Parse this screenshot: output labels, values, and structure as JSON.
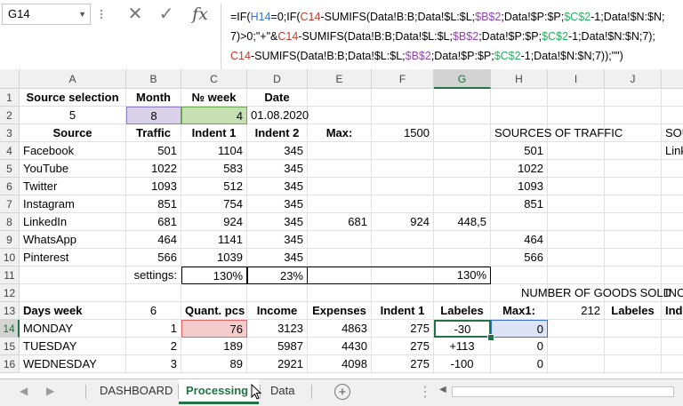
{
  "formula_bar": {
    "name_box": "G14",
    "formula_lines": [
      [
        [
          "=IF(",
          ""
        ],
        [
          "H14",
          "b"
        ],
        [
          "=0;IF(",
          ""
        ],
        [
          "C14",
          "r"
        ],
        [
          "-SUMIFS(Data!B:B;Data!$L:$L;",
          ""
        ],
        [
          "$B$2",
          "p"
        ],
        [
          ";Data!$P:$P;",
          ""
        ],
        [
          "$C$2",
          "g"
        ],
        [
          "-1;Data!$N:$N;",
          ""
        ]
      ],
      [
        [
          "7)>0;\"+\"&",
          ""
        ],
        [
          "C14",
          "r"
        ],
        [
          "-SUMIFS(Data!B:B;Data!$L:$L;",
          ""
        ],
        [
          "$B$2",
          "p"
        ],
        [
          ";Data!$P:$P;",
          ""
        ],
        [
          "$C$2",
          "g"
        ],
        [
          "-1;Data!$N:$N;7);",
          ""
        ]
      ],
      [
        [
          "C14",
          "r"
        ],
        [
          "-SUMIFS(Data!B:B;Data!$L:$L;",
          ""
        ],
        [
          "$B$2",
          "p"
        ],
        [
          ";Data!$P:$P;",
          ""
        ],
        [
          "$C$2",
          "g"
        ],
        [
          "-1;Data!$N:$N;7));\"\")",
          ""
        ]
      ]
    ]
  },
  "columns": [
    "A",
    "B",
    "C",
    "D",
    "E",
    "F",
    "G",
    "H",
    "I",
    "J"
  ],
  "rows": [
    1,
    2,
    3,
    4,
    5,
    6,
    7,
    8,
    9,
    10,
    11,
    12,
    13,
    14,
    15,
    16
  ],
  "selected_cell": "G14",
  "cells": [
    {
      "r": 1,
      "c": "A",
      "v": "Source selection",
      "s": "b c"
    },
    {
      "r": 1,
      "c": "B",
      "v": "Month",
      "s": "b c"
    },
    {
      "r": 1,
      "c": "C",
      "v": "№ week",
      "s": "b c"
    },
    {
      "r": 1,
      "c": "D",
      "v": "Date",
      "s": "b c"
    },
    {
      "r": 2,
      "c": "A",
      "v": "5",
      "s": "c"
    },
    {
      "r": 2,
      "c": "B",
      "v": "8",
      "s": "c",
      "bg": "#d9d2e9",
      "bd": "#8e7cc3"
    },
    {
      "r": 2,
      "c": "C",
      "v": "4",
      "s": "r",
      "bg": "#c6e0b4",
      "bd": "#6aa84f"
    },
    {
      "r": 2,
      "c": "D",
      "v": "01.08.2020",
      "s": "r"
    },
    {
      "r": 3,
      "c": "A",
      "v": "Source",
      "s": "b c"
    },
    {
      "r": 3,
      "c": "B",
      "v": "Traffic",
      "s": "b c"
    },
    {
      "r": 3,
      "c": "C",
      "v": "Indent 1",
      "s": "b c"
    },
    {
      "r": 3,
      "c": "D",
      "v": "Indent 2",
      "s": "b c"
    },
    {
      "r": 3,
      "c": "E",
      "v": "Max:",
      "s": "b c"
    },
    {
      "r": 3,
      "c": "F",
      "v": "1500",
      "s": "r"
    },
    {
      "r": 3,
      "c": "H",
      "v": "SOURCES OF TRAFFIC",
      "s": "l"
    },
    {
      "r": 3,
      "c": "J2",
      "v": "SOU",
      "s": "l"
    },
    {
      "r": 4,
      "c": "A",
      "v": "Facebook",
      "s": "l"
    },
    {
      "r": 4,
      "c": "B",
      "v": "501",
      "s": "r"
    },
    {
      "r": 4,
      "c": "C",
      "v": "1104",
      "s": "r"
    },
    {
      "r": 4,
      "c": "D",
      "v": "345",
      "s": "r"
    },
    {
      "r": 4,
      "c": "H",
      "v": "501",
      "s": "r"
    },
    {
      "r": 4,
      "c": "J2",
      "v": "Link",
      "s": "l"
    },
    {
      "r": 5,
      "c": "A",
      "v": "YouTube",
      "s": "l"
    },
    {
      "r": 5,
      "c": "B",
      "v": "1022",
      "s": "r"
    },
    {
      "r": 5,
      "c": "C",
      "v": "583",
      "s": "r"
    },
    {
      "r": 5,
      "c": "D",
      "v": "345",
      "s": "r"
    },
    {
      "r": 5,
      "c": "H",
      "v": "1022",
      "s": "r"
    },
    {
      "r": 6,
      "c": "A",
      "v": "Twitter",
      "s": "l"
    },
    {
      "r": 6,
      "c": "B",
      "v": "1093",
      "s": "r"
    },
    {
      "r": 6,
      "c": "C",
      "v": "512",
      "s": "r"
    },
    {
      "r": 6,
      "c": "D",
      "v": "345",
      "s": "r"
    },
    {
      "r": 6,
      "c": "H",
      "v": "1093",
      "s": "r"
    },
    {
      "r": 7,
      "c": "A",
      "v": "Instagram",
      "s": "l"
    },
    {
      "r": 7,
      "c": "B",
      "v": "851",
      "s": "r"
    },
    {
      "r": 7,
      "c": "C",
      "v": "754",
      "s": "r"
    },
    {
      "r": 7,
      "c": "D",
      "v": "345",
      "s": "r"
    },
    {
      "r": 7,
      "c": "H",
      "v": "851",
      "s": "r"
    },
    {
      "r": 8,
      "c": "A",
      "v": "LinkedIn",
      "s": "l"
    },
    {
      "r": 8,
      "c": "B",
      "v": "681",
      "s": "r"
    },
    {
      "r": 8,
      "c": "C",
      "v": "924",
      "s": "r"
    },
    {
      "r": 8,
      "c": "D",
      "v": "345",
      "s": "r"
    },
    {
      "r": 8,
      "c": "E",
      "v": "681",
      "s": "r"
    },
    {
      "r": 8,
      "c": "F",
      "v": "924",
      "s": "r"
    },
    {
      "r": 8,
      "c": "G",
      "v": "448,5",
      "s": "r"
    },
    {
      "r": 9,
      "c": "A",
      "v": "WhatsApp",
      "s": "l"
    },
    {
      "r": 9,
      "c": "B",
      "v": "464",
      "s": "r"
    },
    {
      "r": 9,
      "c": "C",
      "v": "1141",
      "s": "r"
    },
    {
      "r": 9,
      "c": "D",
      "v": "345",
      "s": "r"
    },
    {
      "r": 9,
      "c": "H",
      "v": "464",
      "s": "r"
    },
    {
      "r": 10,
      "c": "A",
      "v": "Pinterest",
      "s": "l"
    },
    {
      "r": 10,
      "c": "B",
      "v": "566",
      "s": "r"
    },
    {
      "r": 10,
      "c": "C",
      "v": "1039",
      "s": "r"
    },
    {
      "r": 10,
      "c": "D",
      "v": "345",
      "s": "r"
    },
    {
      "r": 10,
      "c": "H",
      "v": "566",
      "s": "r"
    },
    {
      "r": 11,
      "c": "B",
      "v": "settings:",
      "s": "r"
    },
    {
      "r": 11,
      "c": "C",
      "v": "130%",
      "s": "r",
      "box": true
    },
    {
      "r": 11,
      "c": "D",
      "v": "23%",
      "s": "r",
      "box": true
    },
    {
      "r": 11,
      "c": "G",
      "v": "130%",
      "s": "r"
    },
    {
      "r": 12,
      "c": "H",
      "v": "NUMBER OF GOODS SOLD",
      "s": "l",
      "shift": 30
    },
    {
      "r": 12,
      "c": "J2",
      "v": "INC",
      "s": "l"
    },
    {
      "r": 13,
      "c": "A",
      "v": "Days week",
      "s": "b l"
    },
    {
      "r": 13,
      "c": "B",
      "v": "6",
      "s": "c"
    },
    {
      "r": 13,
      "c": "C",
      "v": "Quant. pcs",
      "s": "b c"
    },
    {
      "r": 13,
      "c": "D",
      "v": "Income",
      "s": "b c"
    },
    {
      "r": 13,
      "c": "E",
      "v": "Expenses",
      "s": "b c"
    },
    {
      "r": 13,
      "c": "F",
      "v": "Indent 1",
      "s": "b c"
    },
    {
      "r": 13,
      "c": "G",
      "v": "Labeles",
      "s": "b c"
    },
    {
      "r": 13,
      "c": "H",
      "v": "Max1:",
      "s": "b c"
    },
    {
      "r": 13,
      "c": "I",
      "v": "212",
      "s": "r"
    },
    {
      "r": 13,
      "c": "J",
      "v": "Labeles",
      "s": "b c"
    },
    {
      "r": 13,
      "c": "J2",
      "v": "Ind",
      "s": "b l"
    },
    {
      "r": 14,
      "c": "A",
      "v": "MONDAY",
      "s": "l"
    },
    {
      "r": 14,
      "c": "B",
      "v": "1",
      "s": "r"
    },
    {
      "r": 14,
      "c": "C",
      "v": "76",
      "s": "r",
      "bg": "#f4cccc",
      "bd": "#e06666"
    },
    {
      "r": 14,
      "c": "D",
      "v": "3123",
      "s": "r"
    },
    {
      "r": 14,
      "c": "E",
      "v": "4863",
      "s": "r"
    },
    {
      "r": 14,
      "c": "F",
      "v": "275",
      "s": "r"
    },
    {
      "r": 14,
      "c": "G",
      "v": "-30",
      "s": "c",
      "active": true
    },
    {
      "r": 14,
      "c": "H",
      "v": "0",
      "s": "r",
      "bg": "#dde4f5",
      "bd": "#3b6fd6"
    },
    {
      "r": 15,
      "c": "A",
      "v": "TUESDAY",
      "s": "l"
    },
    {
      "r": 15,
      "c": "B",
      "v": "2",
      "s": "r"
    },
    {
      "r": 15,
      "c": "C",
      "v": "189",
      "s": "r"
    },
    {
      "r": 15,
      "c": "D",
      "v": "5987",
      "s": "r"
    },
    {
      "r": 15,
      "c": "E",
      "v": "4430",
      "s": "r"
    },
    {
      "r": 15,
      "c": "F",
      "v": "275",
      "s": "r"
    },
    {
      "r": 15,
      "c": "G",
      "v": "+113",
      "s": "c"
    },
    {
      "r": 15,
      "c": "H",
      "v": "0",
      "s": "r"
    },
    {
      "r": 16,
      "c": "A",
      "v": "WEDNESDAY",
      "s": "l"
    },
    {
      "r": 16,
      "c": "B",
      "v": "3",
      "s": "r"
    },
    {
      "r": 16,
      "c": "C",
      "v": "89",
      "s": "r"
    },
    {
      "r": 16,
      "c": "D",
      "v": "2921",
      "s": "r"
    },
    {
      "r": 16,
      "c": "E",
      "v": "4098",
      "s": "r"
    },
    {
      "r": 16,
      "c": "F",
      "v": "275",
      "s": "r"
    },
    {
      "r": 16,
      "c": "G",
      "v": "-100",
      "s": "c"
    },
    {
      "r": 16,
      "c": "H",
      "v": "0",
      "s": "r"
    }
  ],
  "sheet_tabs": [
    "DASHBOARD",
    "Processing",
    "Data"
  ],
  "active_tab": "Processing",
  "add_sheet_label": "+"
}
